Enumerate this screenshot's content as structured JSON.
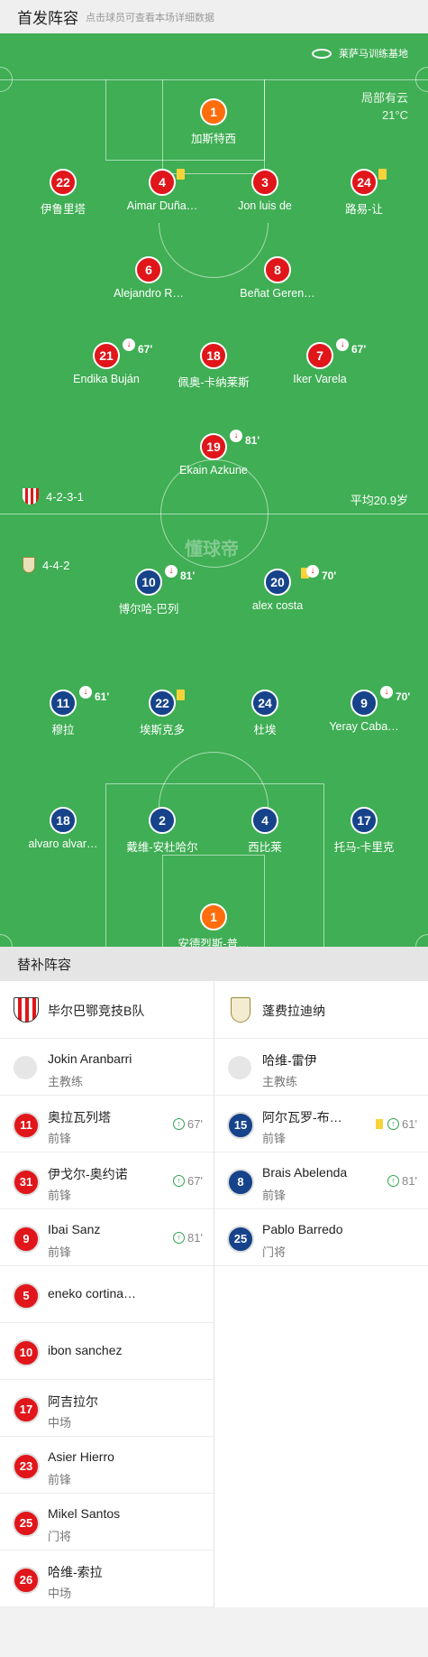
{
  "header": {
    "title": "首发阵容",
    "subtitle": "点击球员可查看本场详细数据"
  },
  "pitch": {
    "venue": "莱萨马训练基地",
    "weather": "局部有云",
    "temp": "21°C",
    "home_formation": "4-2-3-1",
    "away_formation": "4-4-2",
    "avg_age": "平均20.9岁",
    "watermark": "懂球帝"
  },
  "home_players": [
    {
      "n": "1",
      "name": "加斯特西",
      "style": "orange"
    },
    {
      "n": "22",
      "name": "伊鲁里塔",
      "style": "red"
    },
    {
      "n": "4",
      "name": "Aimar Duña…",
      "style": "red",
      "yellow": true
    },
    {
      "n": "3",
      "name": "Jon luis de",
      "style": "red"
    },
    {
      "n": "24",
      "name": "路易-让",
      "style": "red",
      "yellow": true
    },
    {
      "n": "6",
      "name": "Alejandro R…",
      "style": "red"
    },
    {
      "n": "8",
      "name": "Beñat Geren…",
      "style": "red"
    },
    {
      "n": "21",
      "name": "Endika Buján",
      "style": "red",
      "sub": "67'"
    },
    {
      "n": "18",
      "name": "佩奥-卡纳莱斯",
      "style": "red"
    },
    {
      "n": "7",
      "name": "Iker Varela",
      "style": "red",
      "sub": "67'"
    },
    {
      "n": "19",
      "name": "Ekain Azkune",
      "style": "red",
      "sub": "81'"
    }
  ],
  "away_players": [
    {
      "n": "10",
      "name": "博尔哈-巴列",
      "style": "blue",
      "sub": "81'"
    },
    {
      "n": "20",
      "name": "alex costa",
      "style": "blue",
      "yellow": true,
      "sub": "70'"
    },
    {
      "n": "11",
      "name": "穆拉",
      "style": "blue",
      "sub": "61'"
    },
    {
      "n": "22",
      "name": "埃斯克多",
      "style": "blue",
      "yellow": true
    },
    {
      "n": "24",
      "name": "杜埃",
      "style": "blue"
    },
    {
      "n": "9",
      "name": "Yeray Caba…",
      "style": "blue",
      "sub": "70'"
    },
    {
      "n": "18",
      "name": "alvaro alvar…",
      "style": "blue"
    },
    {
      "n": "2",
      "name": "戴维-安杜哈尔",
      "style": "blue"
    },
    {
      "n": "4",
      "name": "西比莱",
      "style": "blue"
    },
    {
      "n": "17",
      "name": "托马-卡里克",
      "style": "blue"
    },
    {
      "n": "1",
      "name": "安德烈斯-普…",
      "style": "orange"
    }
  ],
  "subs": {
    "title": "替补阵容",
    "home_team": "毕尔巴鄂竞技B队",
    "away_team": "蓬费拉迪纳",
    "home_coach": {
      "name": "Jokin Aranbarri",
      "role": "主教练"
    },
    "away_coach": {
      "name": "哈维-雷伊",
      "role": "主教练"
    },
    "home": [
      {
        "n": "11",
        "name": "奥拉瓦列塔",
        "pos": "前锋",
        "min": "67'"
      },
      {
        "n": "31",
        "name": "伊戈尔-奥约诺",
        "pos": "前锋",
        "min": "67'"
      },
      {
        "n": "9",
        "name": "Ibai Sanz",
        "pos": "前锋",
        "min": "81'"
      },
      {
        "n": "5",
        "name": "eneko cortina…",
        "pos": ""
      },
      {
        "n": "10",
        "name": "ibon sanchez",
        "pos": ""
      },
      {
        "n": "17",
        "name": "阿吉拉尔",
        "pos": "中场"
      },
      {
        "n": "23",
        "name": "Asier Hierro",
        "pos": "前锋"
      },
      {
        "n": "25",
        "name": "Mikel Santos",
        "pos": "门将"
      },
      {
        "n": "26",
        "name": "哈维-索拉",
        "pos": "中场"
      }
    ],
    "away": [
      {
        "n": "15",
        "name": "阿尔瓦罗-布…",
        "pos": "前锋",
        "min": "61'",
        "yellow": true
      },
      {
        "n": "8",
        "name": "Brais Abelenda",
        "pos": "前锋",
        "min": "81'"
      },
      {
        "n": "25",
        "name": "Pablo Barredo",
        "pos": "门将"
      }
    ]
  }
}
